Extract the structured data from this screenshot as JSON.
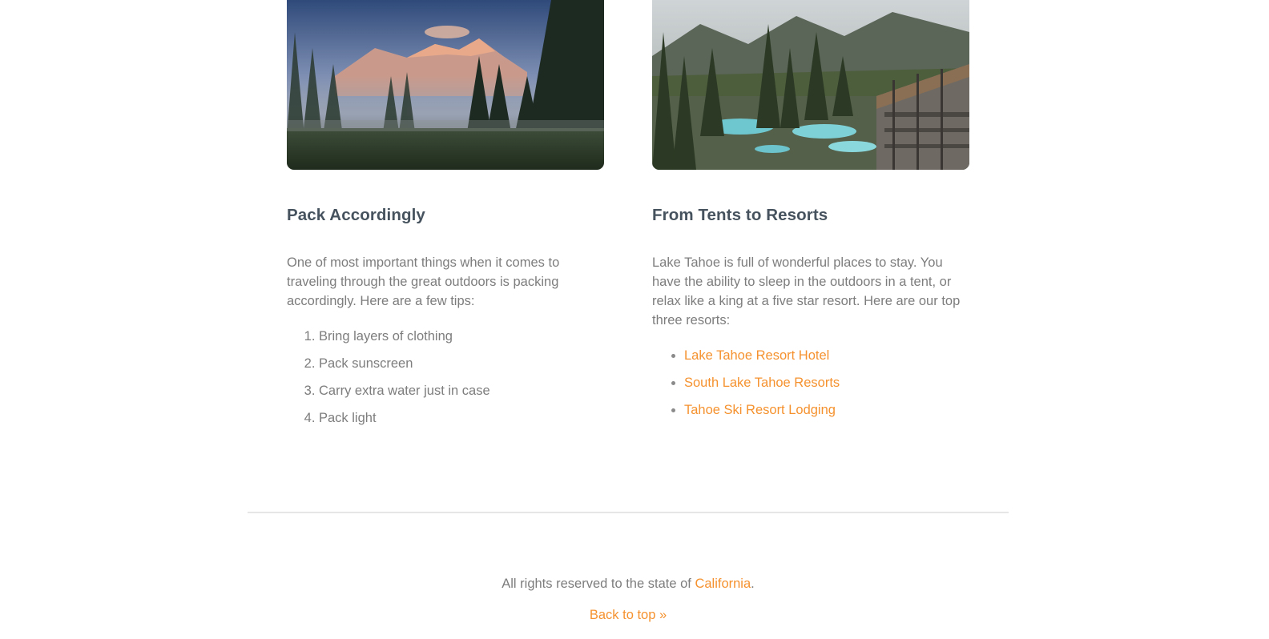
{
  "colors": {
    "heading": "#46535e",
    "body_text": "#7d7d7d",
    "link": "#f5922f",
    "divider": "#e6e6e6"
  },
  "images": {
    "left": "misty-forest-meadow-photo",
    "right": "resort-pool-mountain-photo"
  },
  "pack": {
    "heading": "Pack Accordingly",
    "intro": "One of most important things when it comes to traveling through the great outdoors is packing accordingly. Here are a few tips:",
    "tips": [
      "Bring layers of clothing",
      "Pack sunscreen",
      "Carry extra water just in case",
      "Pack light"
    ]
  },
  "resorts": {
    "heading": "From Tents to Resorts",
    "intro": "Lake Tahoe is full of wonderful places to stay. You have the ability to sleep in the outdoors in a tent, or relax like a king at a five star resort. Here are our top three resorts:",
    "links": [
      "Lake Tahoe Resort Hotel",
      "South Lake Tahoe Resorts",
      "Tahoe Ski Resort Lodging"
    ]
  },
  "footer": {
    "rights_prefix": "All rights reserved to the state of ",
    "rights_link": "California",
    "rights_suffix": ".",
    "back_to_top": "Back to top »"
  }
}
